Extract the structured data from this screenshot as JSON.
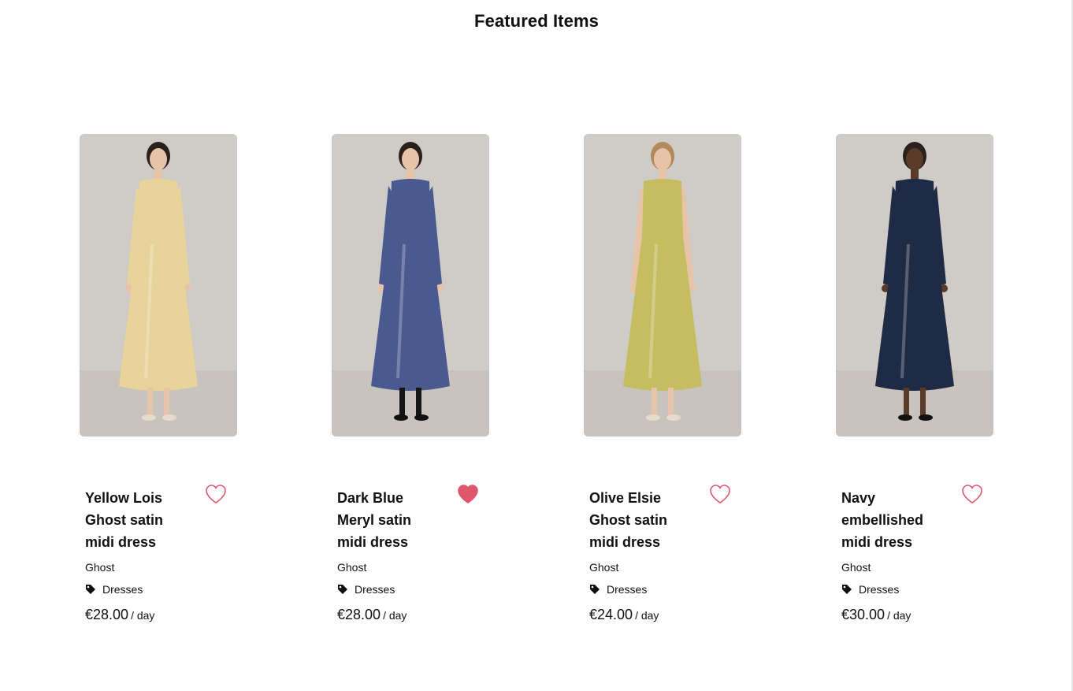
{
  "page": {
    "title": "Featured Items"
  },
  "colors": {
    "heart": "#e0566a",
    "photo_bg": "#cfcbc6"
  },
  "products": [
    {
      "name": "Yellow Lois Ghost satin midi dress",
      "brand": "Ghost",
      "category": "Dresses",
      "price": "€28.00",
      "unit": "/ day",
      "favorited": false,
      "image_icon": "photo-model-yellow-satin-dress",
      "dress_color": "#e8d39a"
    },
    {
      "name": "Dark Blue Meryl satin midi dress",
      "brand": "Ghost",
      "category": "Dresses",
      "price": "€28.00",
      "unit": "/ day",
      "favorited": true,
      "image_icon": "photo-model-dark-blue-satin-dress",
      "dress_color": "#4a5a8f"
    },
    {
      "name": "Olive Elsie Ghost satin midi dress",
      "brand": "Ghost",
      "category": "Dresses",
      "price": "€24.00",
      "unit": "/ day",
      "favorited": false,
      "image_icon": "photo-model-olive-satin-dress",
      "dress_color": "#c5bd60"
    },
    {
      "name": "Navy embellished midi dress",
      "brand": "Ghost",
      "category": "Dresses",
      "price": "€30.00",
      "unit": "/ day",
      "favorited": false,
      "image_icon": "photo-model-navy-embellished-dress",
      "dress_color": "#1f2a44"
    }
  ]
}
